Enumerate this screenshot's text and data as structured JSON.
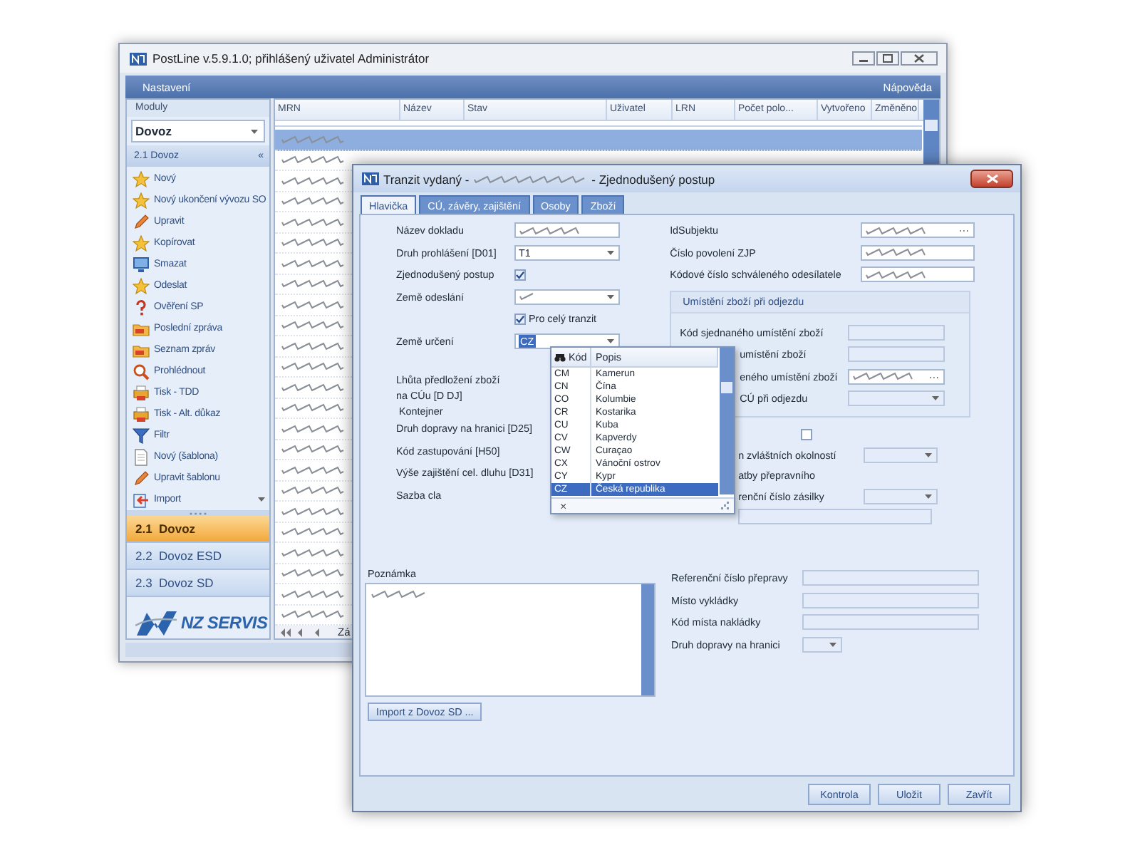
{
  "main_window": {
    "title": "PostLine v.5.9.1.0; přihlášený uživatel Administrátor",
    "menu": [
      "Nastavení",
      "Nápověda"
    ],
    "sidebar": {
      "header": "Moduly",
      "module": "Dovoz",
      "section": "2.1 Dovoz",
      "collapse": "«",
      "items": [
        {
          "label": "Nový"
        },
        {
          "label": "Nový ukončení vývozu SO"
        },
        {
          "label": "Upravit"
        },
        {
          "label": "Kopírovat"
        },
        {
          "label": "Smazat"
        },
        {
          "label": "Odeslat"
        },
        {
          "label": "Ověření SP"
        },
        {
          "label": "Poslední zpráva"
        },
        {
          "label": "Seznam zpráv"
        },
        {
          "label": "Prohlédnout"
        },
        {
          "label": "Tisk - TDD"
        },
        {
          "label": "Tisk - Alt. důkaz"
        },
        {
          "label": "Filtr"
        },
        {
          "label": "Nový (šablona)"
        },
        {
          "label": "Upravit šablonu"
        },
        {
          "label": "Import",
          "expandable": true
        }
      ],
      "modules": [
        {
          "label": "2.1  Dovoz",
          "selected": true
        },
        {
          "label": "2.2  Dovoz ESD",
          "selected": false
        },
        {
          "label": "2.3  Dovoz SD",
          "selected": false
        }
      ],
      "logo": "NZ SERVIS"
    },
    "grid": {
      "columns": [
        "MRN",
        "Název",
        "Stav",
        "Uživatel",
        "LRN",
        "Počet polo...",
        "Vytvořeno",
        "Změněno"
      ],
      "rows": [
        {
          "selected": true
        },
        {
          "selected": false
        },
        {
          "selected": false
        },
        {
          "selected": false
        },
        {
          "selected": false
        },
        {
          "selected": false
        },
        {
          "selected": false
        },
        {
          "selected": false
        },
        {
          "selected": false
        },
        {
          "selected": false
        },
        {
          "selected": false
        },
        {
          "selected": false
        },
        {
          "selected": false
        },
        {
          "selected": false
        },
        {
          "selected": false
        },
        {
          "selected": false
        },
        {
          "selected": false
        },
        {
          "selected": false
        },
        {
          "selected": false
        },
        {
          "selected": false
        },
        {
          "selected": false
        },
        {
          "selected": false
        },
        {
          "selected": false
        },
        {
          "selected": false
        }
      ],
      "pager": "Zá"
    }
  },
  "dialog": {
    "title": [
      "Tranzit vydaný -",
      "- Zjednodušený postup"
    ],
    "tabs": [
      {
        "label": "Hlavička",
        "selected": true
      },
      {
        "label": "CÚ, závěry, zajištění",
        "selected": false
      },
      {
        "label": "Osoby",
        "selected": false
      },
      {
        "label": "Zboží",
        "selected": false
      }
    ],
    "left_fields": [
      {
        "kind": "text",
        "label": "Název dokladu",
        "obscured": true
      },
      {
        "kind": "select",
        "label": "Druh prohlášení [D01]",
        "value": "T1"
      },
      {
        "kind": "checkbox",
        "label": "Zjednodušený postup",
        "checked": true
      },
      {
        "kind": "select",
        "label": "Země odeslání",
        "obscured": true
      },
      {
        "kind": "checkbox",
        "text": "Pro celý tranzit",
        "checked": true
      },
      {
        "kind": "select",
        "label": "Země určení",
        "value": "CZ",
        "focused": true
      },
      {
        "kind": "label",
        "label": "Lhůta předložení zboží\nna CÚu [D DJ]"
      },
      {
        "kind": "label",
        "label": " Kontejner"
      },
      {
        "kind": "label",
        "label": "Druh dopravy na hranici [D25]"
      },
      {
        "kind": "label",
        "label": "Kód zastupování [H50]"
      },
      {
        "kind": "label",
        "label": "Výše zajištění cel. dluhu [D31]"
      },
      {
        "kind": "label",
        "label": "Sazba cla"
      }
    ],
    "right_fields": [
      {
        "kind": "text",
        "label": "IdSubjektu",
        "obscured": true,
        "browse": "···"
      },
      {
        "kind": "text",
        "label": "Číslo povolení ZJP",
        "obscured": true
      },
      {
        "kind": "text",
        "label": "Kódové číslo schváleného odesílatele",
        "obscured": true
      }
    ],
    "location_group": {
      "title": "Umístění zboží při odjezdu",
      "fields": [
        {
          "kind": "text",
          "label": "Kód sjednaného umístění zboží",
          "disabled": true
        },
        {
          "kind": "text",
          "label": "umístění zboží",
          "covered": true,
          "disabled": true
        },
        {
          "kind": "text",
          "label": "eného umístění zboží",
          "covered": true,
          "obscured": true,
          "browse": "···"
        },
        {
          "kind": "select",
          "label": "CÚ při odjezdu",
          "covered": true,
          "disabled": true
        }
      ]
    },
    "right_more": [
      {
        "kind": "checkbox",
        "checked": false
      },
      {
        "kind": "select",
        "label": "n zvláštních okolností",
        "covered": true,
        "disabled": true
      },
      {
        "kind": "label",
        "label": "atby přepravního",
        "covered": true
      },
      {
        "kind": "select",
        "label": "renční číslo zásilky",
        "covered": true,
        "disabled": true
      },
      {
        "kind": "text",
        "covered": true,
        "disabled": true
      }
    ],
    "note": {
      "label": "Poznámka",
      "obscured": true
    },
    "import_button": "Import z Dovoz SD ...",
    "transport_fields": [
      {
        "kind": "text",
        "label": "Referenční číslo přepravy",
        "disabled": true
      },
      {
        "kind": "text",
        "label": "Místo vykládky",
        "disabled": true
      },
      {
        "kind": "text",
        "label": "Kód místa nakládky",
        "disabled": true
      },
      {
        "kind": "select",
        "label": "Druh dopravy na hranici",
        "disabled": true
      }
    ],
    "country_list": {
      "columns": [
        "Kód",
        "Popis"
      ],
      "clear": "×",
      "rows": [
        {
          "code": "CM",
          "name": "Kamerun",
          "selected": false
        },
        {
          "code": "CN",
          "name": "Čína",
          "selected": false
        },
        {
          "code": "CO",
          "name": "Kolumbie",
          "selected": false
        },
        {
          "code": "CR",
          "name": "Kostarika",
          "selected": false
        },
        {
          "code": "CU",
          "name": "Kuba",
          "selected": false
        },
        {
          "code": "CV",
          "name": "Kapverdy",
          "selected": false
        },
        {
          "code": "CW",
          "name": "Curaçao",
          "selected": false
        },
        {
          "code": "CX",
          "name": "Vánoční ostrov",
          "selected": false
        },
        {
          "code": "CY",
          "name": "Kypr",
          "selected": false
        },
        {
          "code": "CZ",
          "name": "Česká republika",
          "selected": true
        }
      ]
    },
    "buttons": [
      "Kontrola",
      "Uložit",
      "Zavřít"
    ]
  }
}
